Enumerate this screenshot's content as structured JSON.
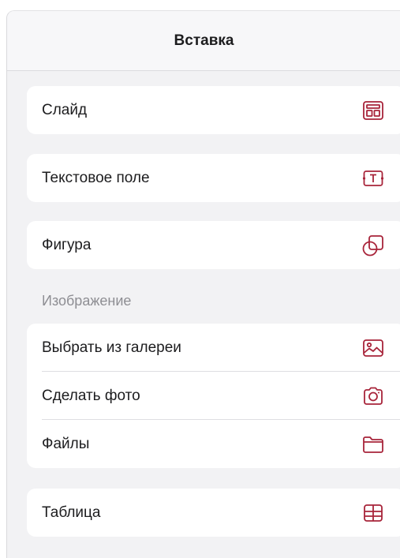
{
  "header": {
    "title": "Вставка"
  },
  "items": {
    "slide": {
      "label": "Слайд",
      "icon": "slide-layout-icon"
    },
    "text_field": {
      "label": "Текстовое поле",
      "icon": "text-box-icon"
    },
    "shape": {
      "label": "Фигура",
      "icon": "shape-icon"
    },
    "table": {
      "label": "Таблица",
      "icon": "table-icon"
    }
  },
  "image_section": {
    "title": "Изображение",
    "items": [
      {
        "label": "Выбрать из галереи",
        "icon": "gallery-icon"
      },
      {
        "label": "Сделать фото",
        "icon": "camera-icon"
      },
      {
        "label": "Файлы",
        "icon": "folder-icon"
      }
    ]
  },
  "colors": {
    "accent": "#a8243a",
    "background": "#f2f2f4",
    "card": "#ffffff",
    "secondary_text": "#8e8e93"
  }
}
